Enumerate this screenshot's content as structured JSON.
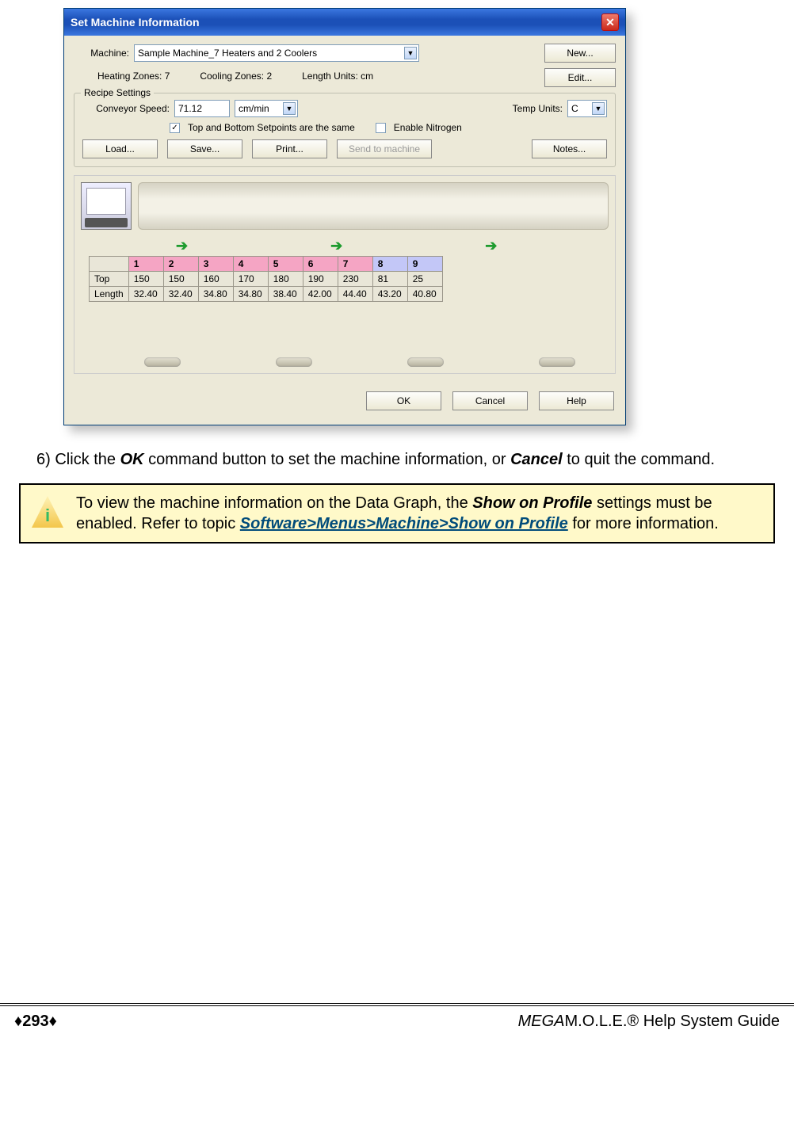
{
  "dialog": {
    "title": "Set Machine Information",
    "machine_label": "Machine:",
    "machine_value": "Sample Machine_7 Heaters and 2 Coolers",
    "new_btn": "New...",
    "edit_btn": "Edit...",
    "heating_zones_label": "Heating Zones: 7",
    "cooling_zones_label": "Cooling Zones: 2",
    "length_units_label": "Length Units: cm",
    "recipe_legend": "Recipe Settings",
    "conv_label": "Conveyor Speed:",
    "conv_value": "71.12",
    "conv_unit": "cm/min",
    "temp_units_label": "Temp Units:",
    "temp_units_value": "C",
    "chk_same": "Top and Bottom Setpoints are the same",
    "chk_nitro": "Enable Nitrogen",
    "load_btn": "Load...",
    "save_btn": "Save...",
    "print_btn": "Print...",
    "send_btn": "Send to machine",
    "notes_btn": "Notes...",
    "ok_btn": "OK",
    "cancel_btn": "Cancel",
    "help_btn": "Help",
    "zone_headers": [
      "1",
      "2",
      "3",
      "4",
      "5",
      "6",
      "7",
      "8",
      "9"
    ],
    "row_labels": {
      "top": "Top",
      "length": "Length"
    },
    "top_vals": [
      "150",
      "150",
      "160",
      "170",
      "180",
      "190",
      "230",
      "81",
      "25"
    ],
    "length_vals": [
      "32.40",
      "32.40",
      "34.80",
      "34.80",
      "38.40",
      "42.00",
      "44.40",
      "43.20",
      "40.80"
    ]
  },
  "step": {
    "num": "6)",
    "p1a": "Click the ",
    "ok": "OK",
    "p1b": " command button to set the machine information, or ",
    "cancel": "Cancel",
    "p1c": " to quit the command."
  },
  "info": {
    "t1": "To view the machine information on the Data Graph, the ",
    "bold1": "Show on Profile",
    "t2": " settings must be enabled. Refer to topic ",
    "link": "Software>Menus>Machine>Show on Profile",
    "t3": " for more information."
  },
  "footer": {
    "page": "293",
    "brand_i": "MEGA",
    "brand_r": "M.O.L.E.® Help System Guide"
  }
}
